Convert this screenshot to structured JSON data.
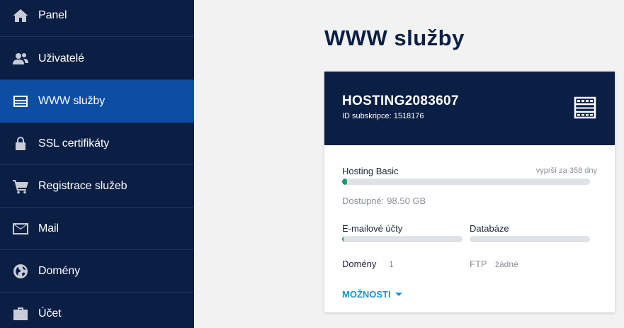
{
  "sidebar": {
    "items": [
      {
        "label": "Panel",
        "icon": "home-icon",
        "active": false
      },
      {
        "label": "Uživatelé",
        "icon": "users-icon",
        "active": false
      },
      {
        "label": "WWW služby",
        "icon": "server-icon",
        "active": true
      },
      {
        "label": "SSL certifikáty",
        "icon": "lock-icon",
        "active": false
      },
      {
        "label": "Registrace služeb",
        "icon": "cart-icon",
        "active": false
      },
      {
        "label": "Mail",
        "icon": "envelope-icon",
        "active": false
      },
      {
        "label": "Domény",
        "icon": "globe-icon",
        "active": false
      },
      {
        "label": "Účet",
        "icon": "briefcase-icon",
        "active": false
      }
    ]
  },
  "main": {
    "title": "WWW služby",
    "card": {
      "name": "HOSTING2083607",
      "subscription_label": "ID subskripce:",
      "subscription_id": "1518176",
      "icon": "server-rack-icon",
      "plan": "Hosting Basic",
      "expiry": "vyprší za 358 dny",
      "available_label": "Dostupné:",
      "available_value": "98.50 GB",
      "email_label": "E-mailové účty",
      "db_label": "Databáze",
      "domains_label": "Domény",
      "domains_value": "1",
      "ftp_label": "FTP",
      "ftp_value": "žádné",
      "options_label": "MOŽNOSTI"
    }
  },
  "colors": {
    "sidebar_bg": "#0b1f45",
    "sidebar_active": "#0d4ea3",
    "progress": "#1a9b6c",
    "link": "#1f8fd8"
  }
}
